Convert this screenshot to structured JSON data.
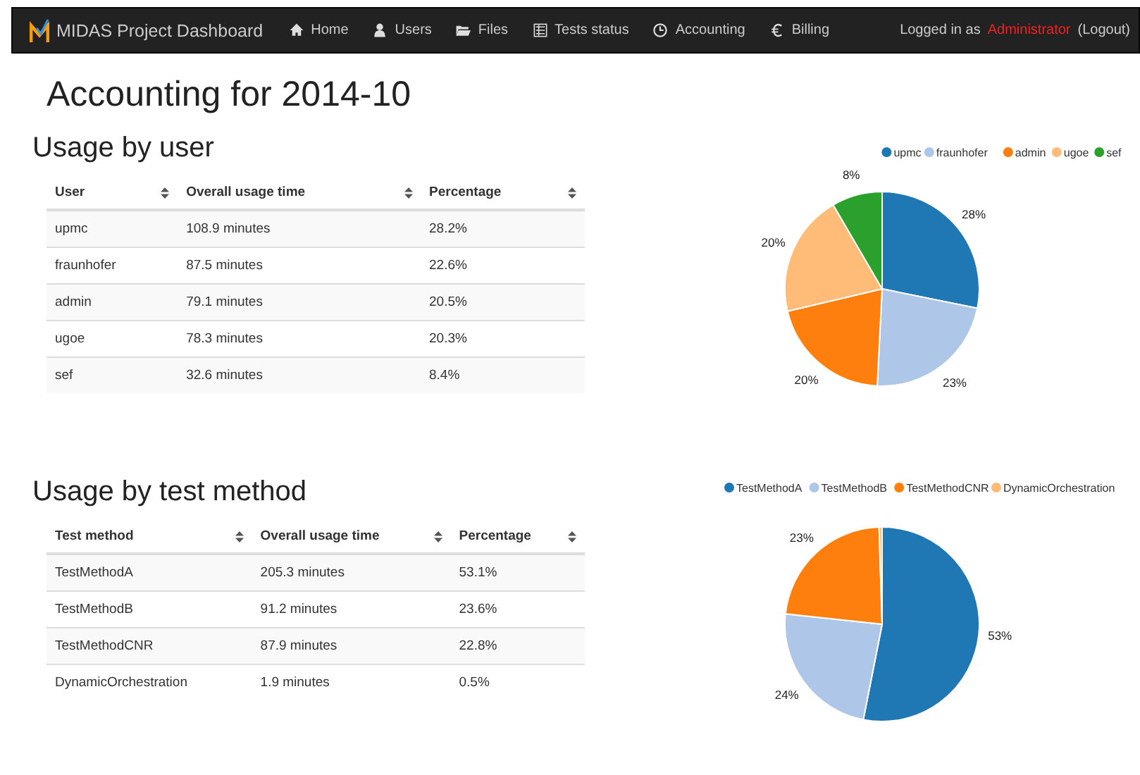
{
  "navbar": {
    "brand": "MIDAS Project Dashboard",
    "items": [
      {
        "label": "Home",
        "selected": false
      },
      {
        "label": "Users",
        "selected": false
      },
      {
        "label": "Files",
        "selected": false
      },
      {
        "label": "Tests status",
        "selected": false
      },
      {
        "label": "Accounting",
        "selected": false
      },
      {
        "label": "Billing",
        "selected": false
      }
    ],
    "login_prefix": "Logged in as",
    "user": "Administrator",
    "logout": "(Logout)"
  },
  "title": "Accounting for 2014-10",
  "sections": [
    {
      "heading": "Usage by user",
      "columns": [
        "User",
        "Overall usage time",
        "Percentage"
      ],
      "rows": [
        [
          "upmc",
          "108.9 minutes",
          "28.2%"
        ],
        [
          "fraunhofer",
          "87.5 minutes",
          "22.6%"
        ],
        [
          "admin",
          "79.1 minutes",
          "20.5%"
        ],
        [
          "ugoe",
          "78.3 minutes",
          "20.3%"
        ],
        [
          "sef",
          "32.6 minutes",
          "8.4%"
        ]
      ],
      "chart_data": {
        "type": "pie",
        "categories": [
          "upmc",
          "fraunhofer",
          "admin",
          "ugoe",
          "sef"
        ],
        "values": [
          28.2,
          22.6,
          20.5,
          20.3,
          8.4
        ],
        "legend": "top",
        "colors": [
          "#1f77b4",
          "#aec7e8",
          "#ff7f0e",
          "#ffbb78",
          "#2ca02c"
        ],
        "value_labels": [
          "28%",
          "23%",
          "20%",
          "20%",
          "8%"
        ]
      }
    },
    {
      "heading": "Usage by test method",
      "columns": [
        "Test method",
        "Overall usage time",
        "Percentage"
      ],
      "rows": [
        [
          "TestMethodA",
          "205.3 minutes",
          "53.1%"
        ],
        [
          "TestMethodB",
          "91.2 minutes",
          "23.6%"
        ],
        [
          "TestMethodCNR",
          "87.9 minutes",
          "22.8%"
        ],
        [
          "DynamicOrchestration",
          "1.9 minutes",
          "0.5%"
        ]
      ],
      "chart_data": {
        "type": "pie",
        "categories": [
          "TestMethodA",
          "TestMethodB",
          "TestMethodCNR",
          "DynamicOrchestration"
        ],
        "values": [
          53.1,
          23.6,
          22.8,
          0.5
        ],
        "legend": "top",
        "colors": [
          "#1f77b4",
          "#aec7e8",
          "#ff7f0e",
          "#ffbb78"
        ],
        "value_labels": [
          "53%",
          "24%",
          "23%",
          null
        ]
      }
    }
  ]
}
